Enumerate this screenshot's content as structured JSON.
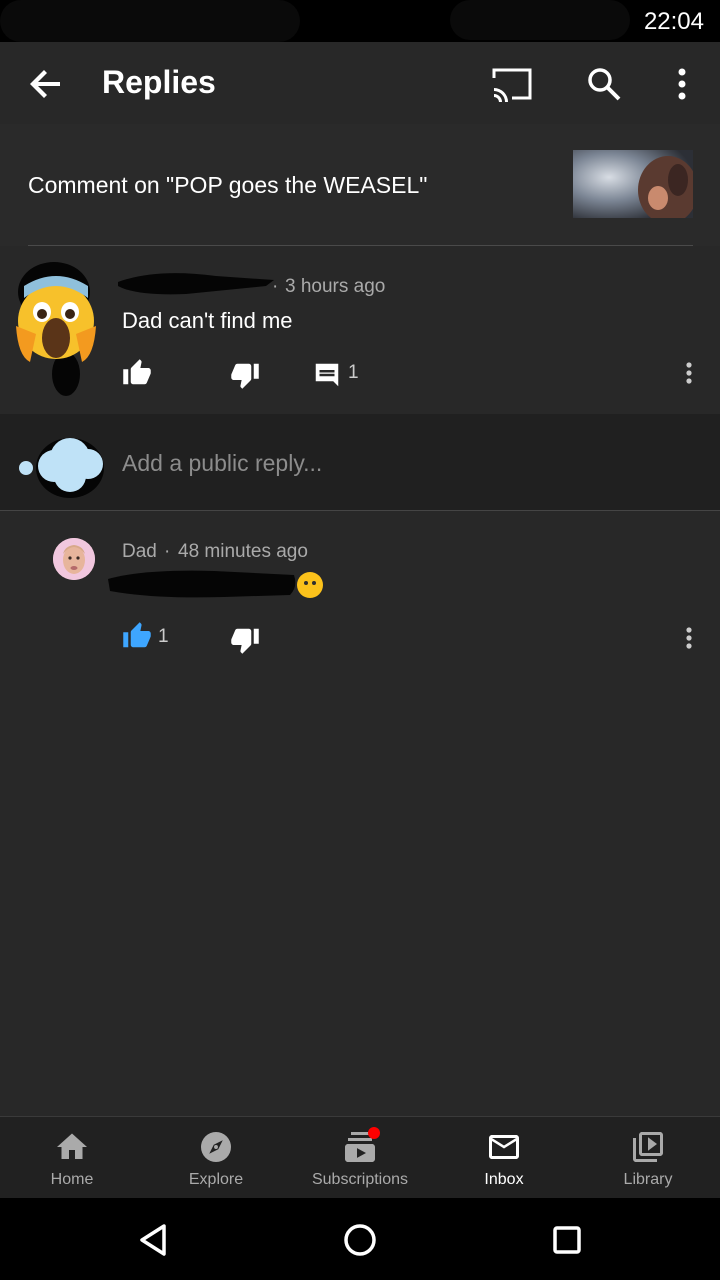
{
  "status": {
    "time": "22:04"
  },
  "appbar": {
    "title": "Replies",
    "icons": {
      "back": "arrow-back-icon",
      "cast": "cast-icon",
      "search": "search-icon",
      "more": "more-vert-icon"
    }
  },
  "section": {
    "title": "Comment on \"POP goes the WEASEL\""
  },
  "comment": {
    "time": "3 hours ago",
    "text": "Dad can't find me",
    "reply_count": "1"
  },
  "reply_box": {
    "placeholder": "Add a public reply..."
  },
  "reply": {
    "author": "Dad",
    "time": "48 minutes ago",
    "like_count": "1"
  },
  "bottom_nav": {
    "items": [
      {
        "label": "Home",
        "icon": "home-icon"
      },
      {
        "label": "Explore",
        "icon": "compass-icon"
      },
      {
        "label": "Subscriptions",
        "icon": "subscriptions-icon"
      },
      {
        "label": "Inbox",
        "icon": "mail-icon"
      },
      {
        "label": "Library",
        "icon": "library-icon"
      }
    ],
    "active_index": 3
  },
  "system_nav": {
    "icons": [
      "back-triangle-icon",
      "home-circle-icon",
      "recents-square-icon"
    ]
  },
  "colors": {
    "background": "#282828",
    "accent_blue": "#3ea6ff",
    "notification_red": "#ff0000"
  }
}
